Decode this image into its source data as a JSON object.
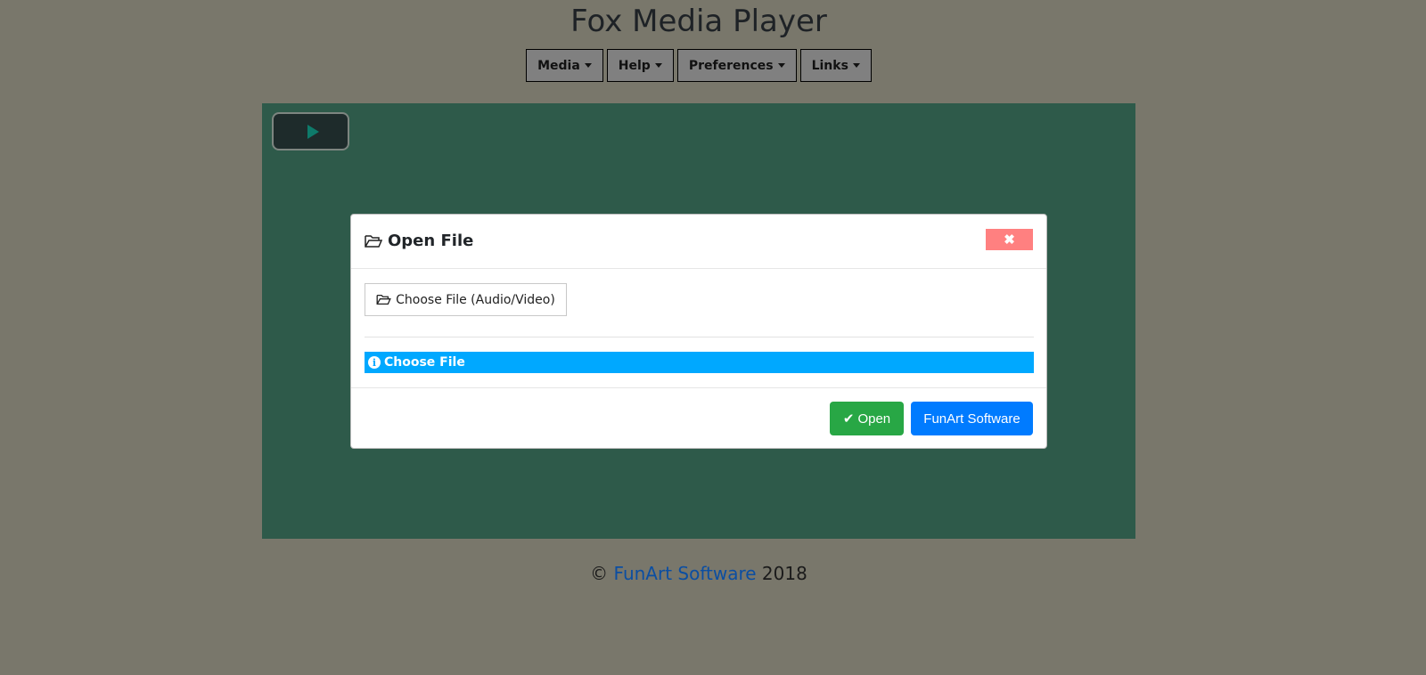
{
  "app": {
    "title": "Fox Media Player"
  },
  "menu": [
    {
      "label": "Media"
    },
    {
      "label": "Help"
    },
    {
      "label": "Preferences"
    },
    {
      "label": "Links"
    }
  ],
  "player": {
    "play_icon": "play-icon"
  },
  "dialog": {
    "title": "Open File",
    "close_icon": "close-icon",
    "choose_button": "Choose File (Audio/Video)",
    "status": "Choose File",
    "open_button": "Open",
    "brand_button": "FunArt Software"
  },
  "footer": {
    "copyright": "©",
    "link": "FunArt Software",
    "year": "2018"
  },
  "colors": {
    "background": "#79776b",
    "player": "#2e5a4a",
    "info": "#00a8ff",
    "open": "#28a745",
    "brand": "#007bff",
    "close": "#ff8080"
  }
}
